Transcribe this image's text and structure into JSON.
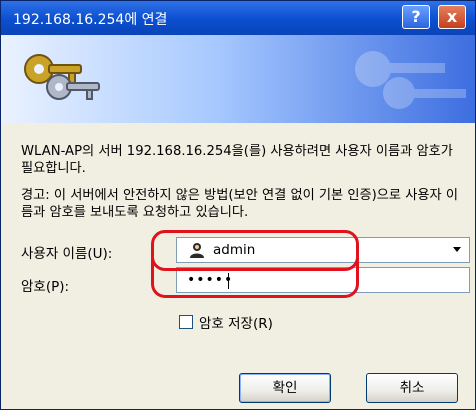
{
  "titlebar": {
    "title": "192.168.16.254에 연결",
    "help_label": "?",
    "close_label": "x"
  },
  "message": {
    "line1": "WLAN-AP의 서버 192.168.16.254을(를) 사용하려면 사용자 이름과 암호가 필요합니다.",
    "line2": "경고: 이 서버에서 안전하지 않은 방법(보안 연결 없이 기본 인증)으로 사용자 이름과 암호를 보내도록 요청하고 있습니다."
  },
  "form": {
    "user_label": "사용자 이름(U):",
    "user_value": "admin",
    "password_label": "암호(P):",
    "password_value": "•••••",
    "remember_label": "암호 저장(R)"
  },
  "buttons": {
    "ok": "확인",
    "cancel": "취소"
  },
  "colors": {
    "highlight": "#e1121b",
    "titlebar": "#0b4fd0"
  }
}
